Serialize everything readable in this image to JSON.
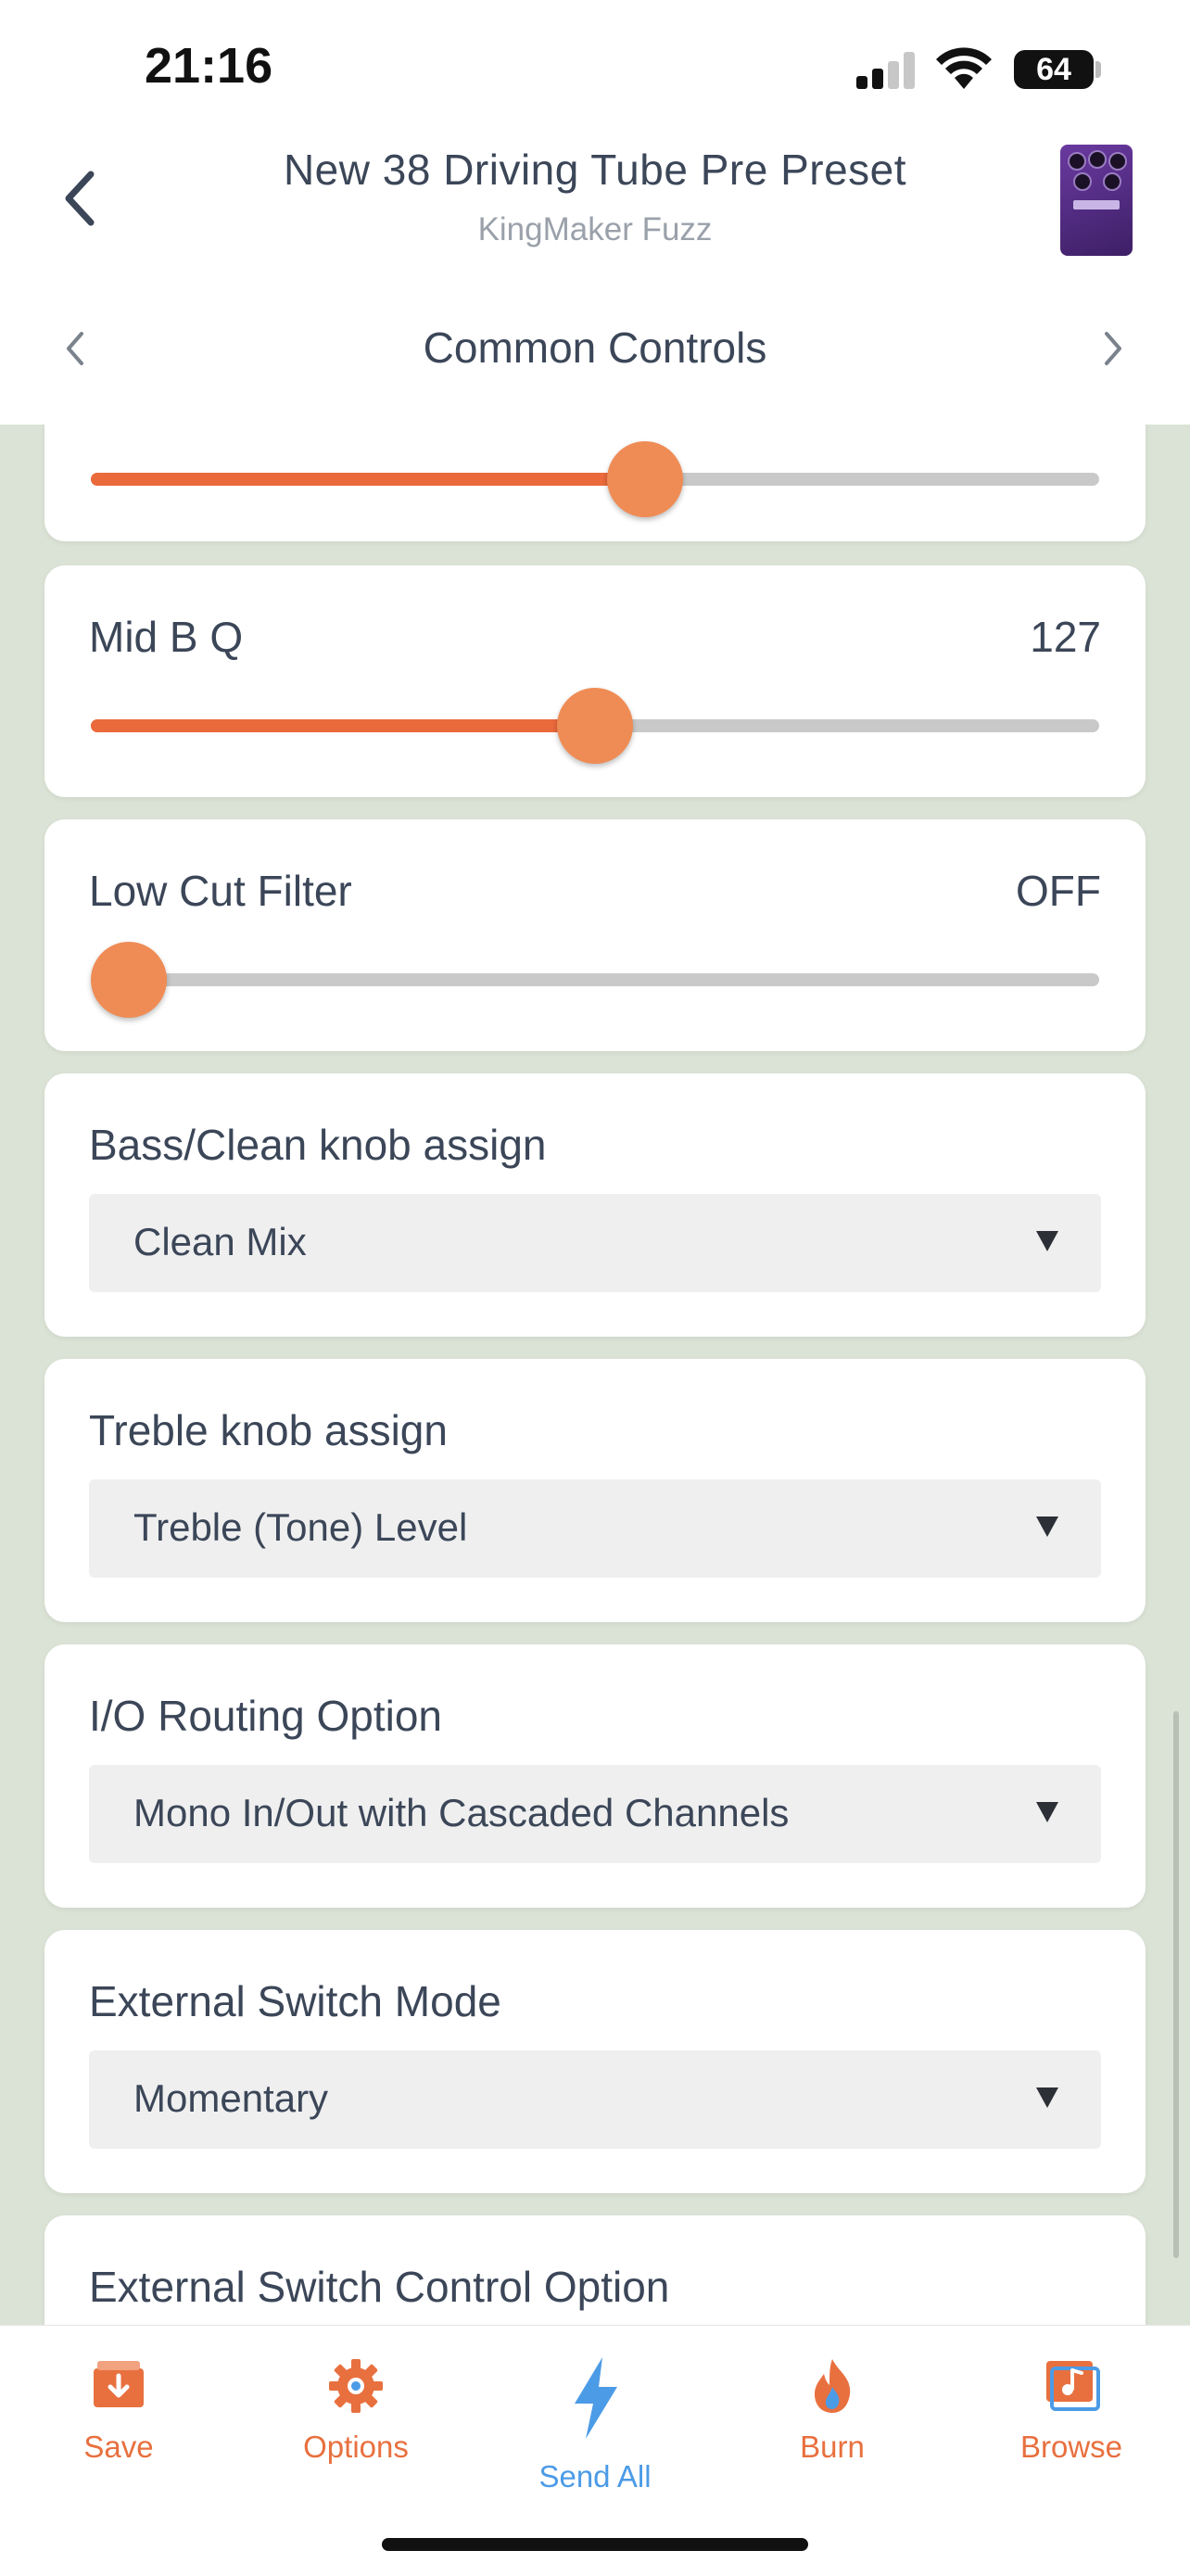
{
  "status": {
    "time": "21:16",
    "battery": "64"
  },
  "header": {
    "title": "New 38 Driving Tube Pre Preset",
    "subtitle": "KingMaker Fuzz",
    "section_title": "Common Controls"
  },
  "sliders": [
    {
      "label": "",
      "value_text": "",
      "level": 0.55
    },
    {
      "label": "Mid B Q",
      "value_text": "127",
      "level": 0.5
    },
    {
      "label": "Low Cut Filter",
      "value_text": "OFF",
      "level": 0.0
    }
  ],
  "dropdowns": [
    {
      "label": "Bass/Clean knob assign",
      "selected": "Clean Mix"
    },
    {
      "label": "Treble knob assign",
      "selected": "Treble (Tone) Level"
    },
    {
      "label": "I/O Routing Option",
      "selected": "Mono In/Out with Cascaded Channels"
    },
    {
      "label": "External Switch Mode",
      "selected": "Momentary"
    },
    {
      "label": "External Switch Control Option",
      "selected": ""
    }
  ],
  "tabbar": {
    "save": "Save",
    "options": "Options",
    "send_all": "Send All",
    "burn": "Burn",
    "browse": "Browse"
  },
  "colors": {
    "accent": "#ea6a3c",
    "thumb": "#ef8c55",
    "active_tab": "#4c9be6",
    "background": "#dbe3d6"
  }
}
